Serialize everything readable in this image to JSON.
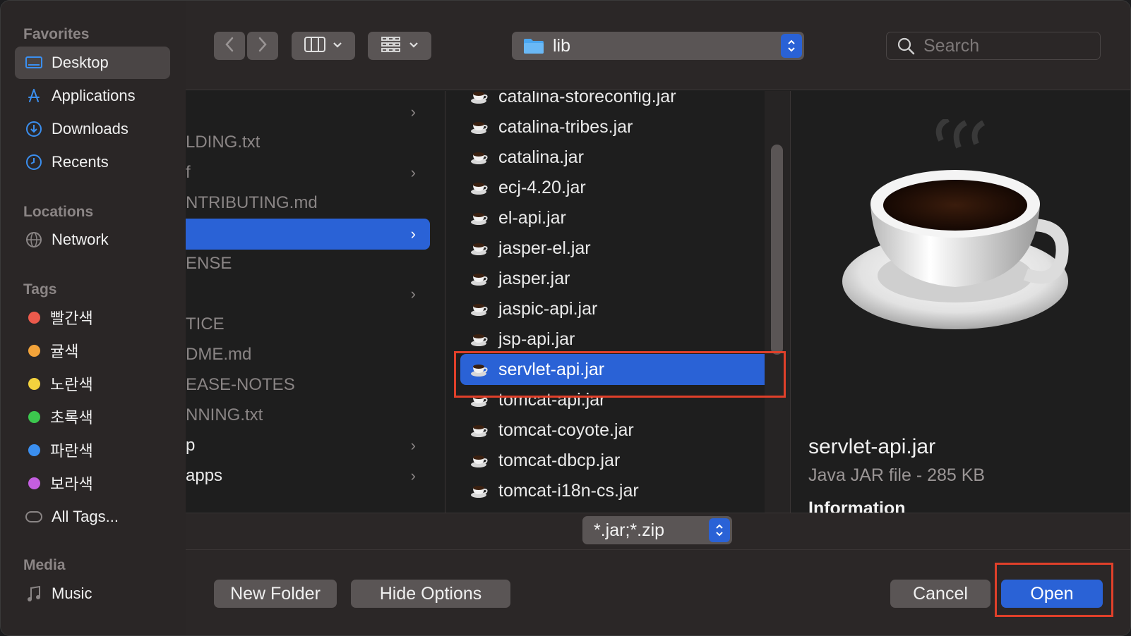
{
  "sidebar": {
    "favorites_header": "Favorites",
    "favorites": [
      {
        "label": "Desktop",
        "icon": "desktop-icon"
      },
      {
        "label": "Applications",
        "icon": "applications-icon"
      },
      {
        "label": "Downloads",
        "icon": "downloads-icon"
      },
      {
        "label": "Recents",
        "icon": "recents-icon"
      }
    ],
    "locations_header": "Locations",
    "locations": [
      {
        "label": "Network",
        "icon": "globe-icon"
      }
    ],
    "tags_header": "Tags",
    "tags": [
      {
        "label": "빨간색",
        "color": "#ec5a4c"
      },
      {
        "label": "귤색",
        "color": "#f2a33a"
      },
      {
        "label": "노란색",
        "color": "#f3d23e"
      },
      {
        "label": "초록색",
        "color": "#3cc74e"
      },
      {
        "label": "파란색",
        "color": "#3b8ff0"
      },
      {
        "label": "보라색",
        "color": "#c45ee0"
      }
    ],
    "all_tags": "All Tags...",
    "media_header": "Media",
    "media": [
      {
        "label": "Music",
        "icon": "music-note-icon"
      }
    ]
  },
  "toolbar": {
    "path_folder": "lib",
    "search_placeholder": "Search"
  },
  "column1": {
    "rows": [
      {
        "label": "",
        "has_chevron": true
      },
      {
        "label": "LDING.txt",
        "has_chevron": false
      },
      {
        "label": "f",
        "has_chevron": true
      },
      {
        "label": "NTRIBUTING.md",
        "has_chevron": false
      },
      {
        "label": "",
        "has_chevron": true,
        "selected": true
      },
      {
        "label": "ENSE",
        "has_chevron": false
      },
      {
        "label": "",
        "has_chevron": true
      },
      {
        "label": "TICE",
        "has_chevron": false
      },
      {
        "label": "DME.md",
        "has_chevron": false
      },
      {
        "label": "EASE-NOTES",
        "has_chevron": false
      },
      {
        "label": "NNING.txt",
        "has_chevron": false
      },
      {
        "label": "p",
        "has_chevron": true
      },
      {
        "label": "apps",
        "has_chevron": true
      }
    ]
  },
  "column2": {
    "files": [
      "catalina-storeconfig.jar",
      "catalina-tribes.jar",
      "catalina.jar",
      "ecj-4.20.jar",
      "el-api.jar",
      "jasper-el.jar",
      "jasper.jar",
      "jaspic-api.jar",
      "jsp-api.jar",
      "servlet-api.jar",
      "tomcat-api.jar",
      "tomcat-coyote.jar",
      "tomcat-dbcp.jar",
      "tomcat-i18n-cs.jar"
    ],
    "selected": "servlet-api.jar"
  },
  "preview": {
    "name": "servlet-api.jar",
    "meta": "Java JAR file - 285 KB",
    "info_header": "Information"
  },
  "format": {
    "filter": "*.jar;*.zip"
  },
  "buttons": {
    "new_folder": "New Folder",
    "hide_options": "Hide Options",
    "cancel": "Cancel",
    "open": "Open"
  },
  "colors": {
    "accent": "#2a62d6",
    "highlight": "#e0402a"
  }
}
